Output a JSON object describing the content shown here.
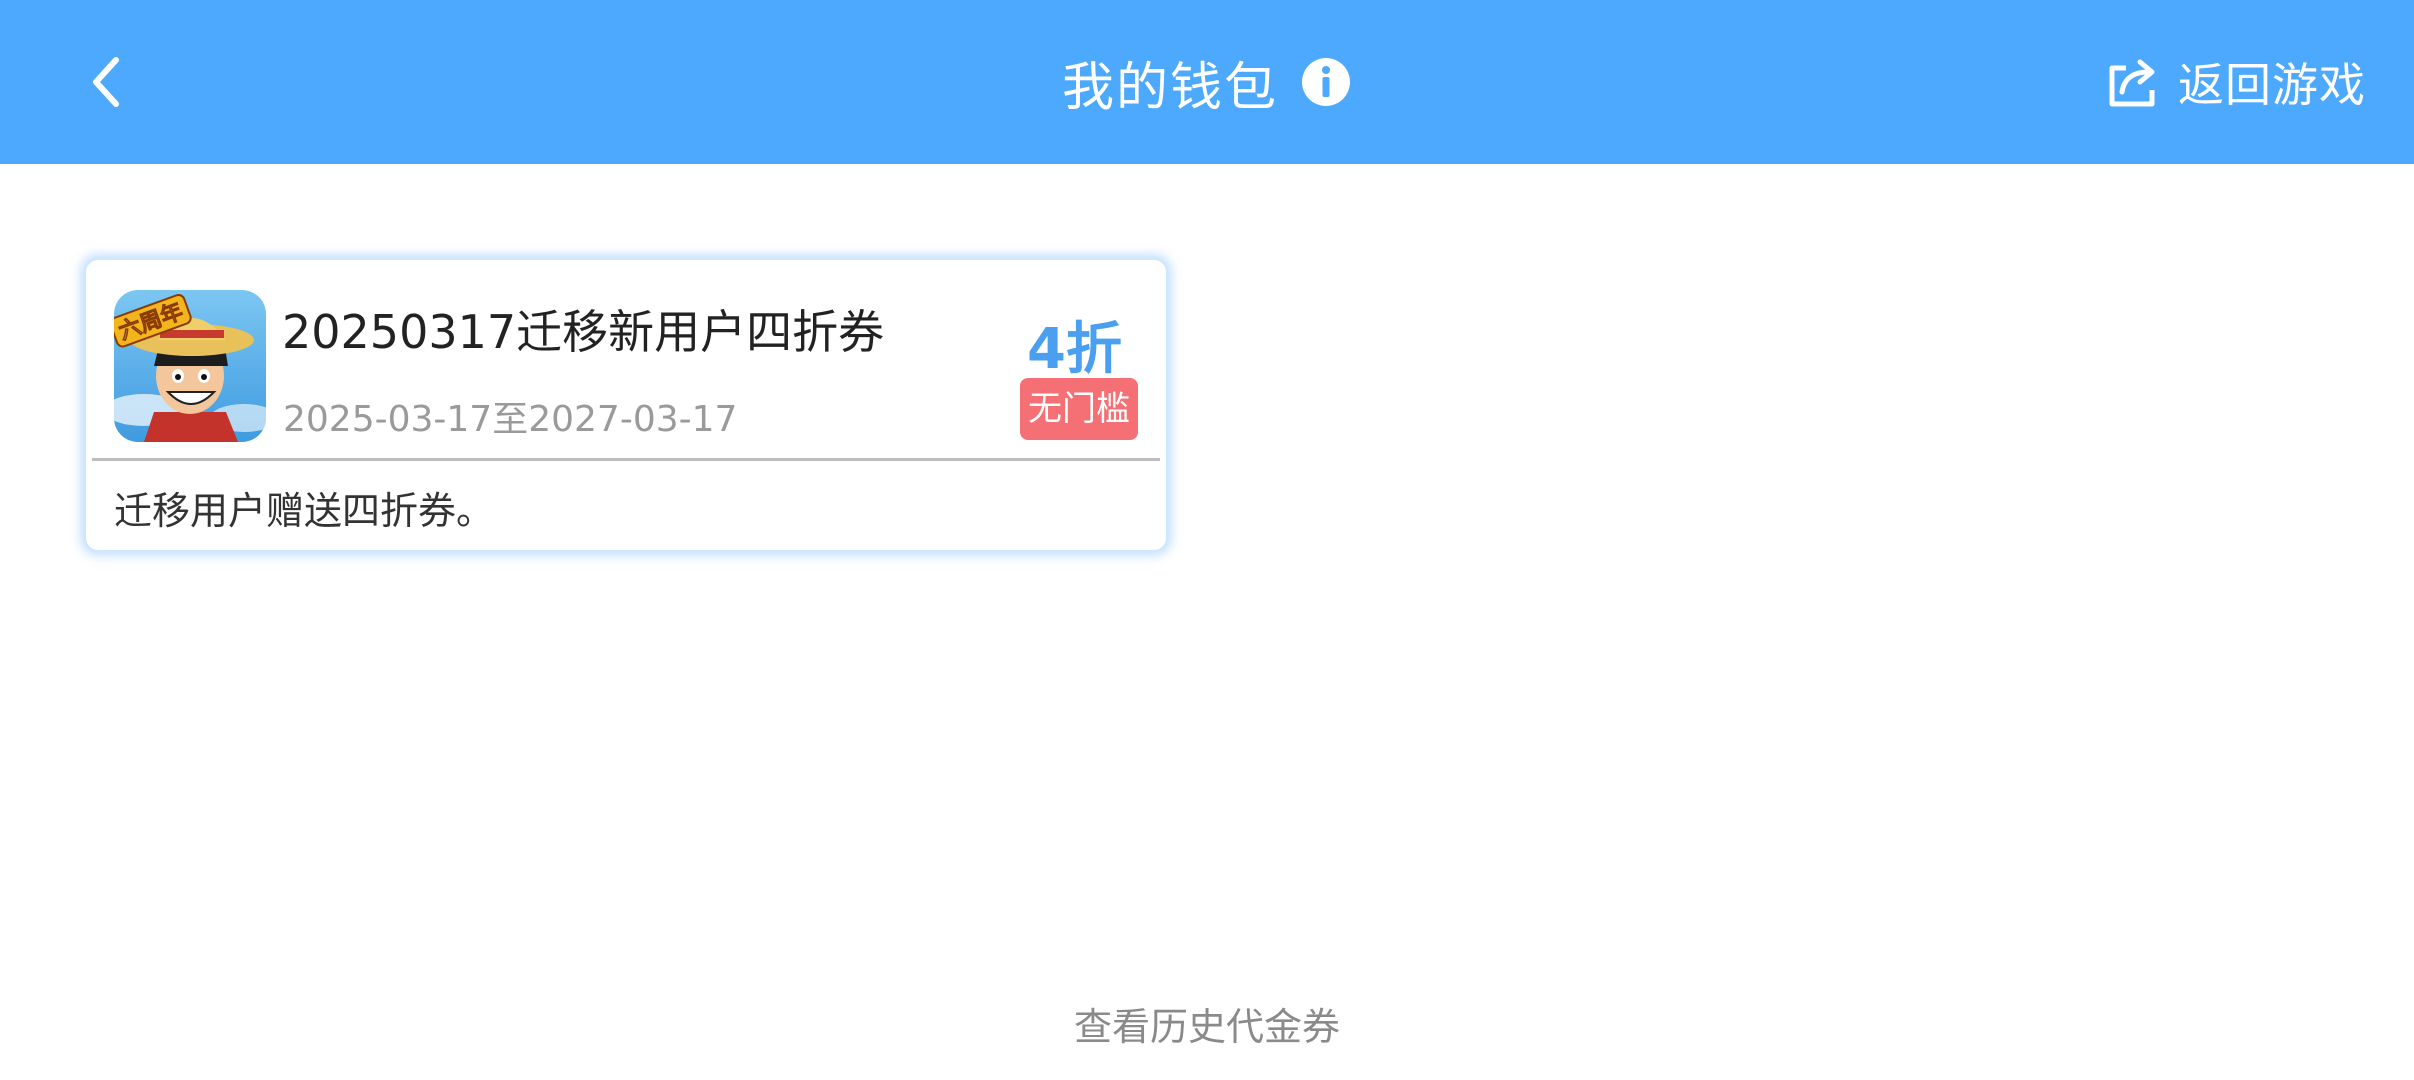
{
  "header": {
    "title": "我的钱包",
    "return_label": "返回游戏"
  },
  "voucher": {
    "name": "20250317迁移新用户四折券",
    "validity": "2025-03-17至2027-03-17",
    "discount": "4折",
    "threshold": "无门槛",
    "description": "迁移用户赠送四折券。",
    "icon_badge_text": "六周年"
  },
  "footer": {
    "history_link": "查看历史代金券"
  },
  "colors": {
    "header_bg": "#4ca9fd",
    "discount": "#4a9ff0",
    "badge_bg": "#f57075"
  },
  "icons": {
    "back": "chevron-left-icon",
    "info": "info-circle-icon",
    "return": "share-arrow-icon"
  }
}
